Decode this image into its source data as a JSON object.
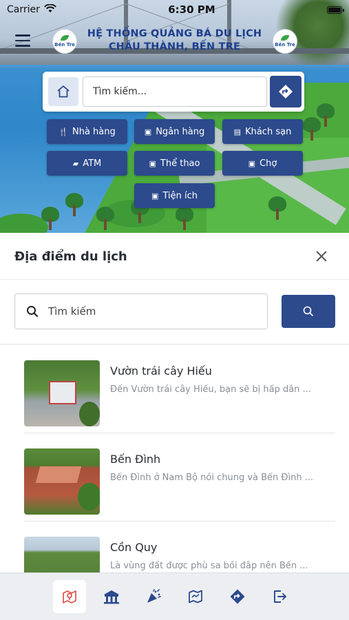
{
  "status_bar": {
    "carrier": "Carrier",
    "time": "6:30 PM"
  },
  "header": {
    "title_line1": "HỆ THỐNG QUẢNG BÁ DU LỊCH",
    "title_line2": "CHÂU THÀNH, BẾN TRE",
    "logo_text": "Bến Tre"
  },
  "top_search": {
    "placeholder": "Tìm kiếm..."
  },
  "categories": [
    {
      "label": "Nhà hàng",
      "icon": "fork-knife-icon"
    },
    {
      "label": "Ngân hàng",
      "icon": "bank-icon"
    },
    {
      "label": "Khách sạn",
      "icon": "hotel-icon"
    },
    {
      "label": "ATM",
      "icon": "atm-icon"
    },
    {
      "label": "Thể thao",
      "icon": "sport-icon"
    },
    {
      "label": "Chợ",
      "icon": "market-icon"
    },
    {
      "label": "Tiện ích",
      "icon": "utility-icon"
    }
  ],
  "panel": {
    "title": "Địa điểm du lịch",
    "search_placeholder": "Tìm kiếm"
  },
  "places": [
    {
      "name": "Vườn trái cây Hiếu",
      "description": "Đến Vườn trái cây Hiếu, bạn sẽ bị hấp dẫn ..."
    },
    {
      "name": "Bến Đình",
      "description": "Bến Đình ở Nam Bộ nói chung và Bến Đình ..."
    },
    {
      "name": "Cồn Quy",
      "description": "Là vùng đất được phù sa bồi đắp nên Bến ..."
    }
  ],
  "tabbar": {
    "tabs": [
      "map-location-icon",
      "temple-icon",
      "festival-icon",
      "map-icon",
      "directions-icon",
      "logout-icon"
    ],
    "active_index": 0
  },
  "colors": {
    "primary": "#2c4a8c",
    "title_blue": "#1e3f8f"
  }
}
